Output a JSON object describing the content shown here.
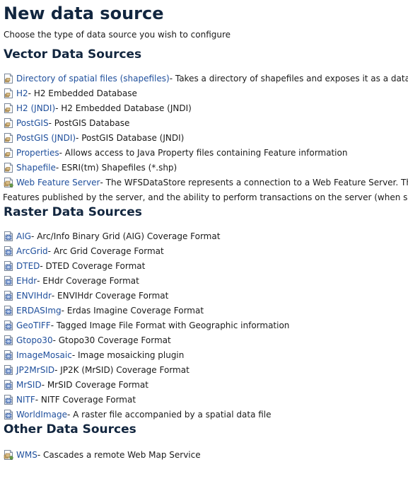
{
  "page": {
    "title": "New data source",
    "subtitle": "Choose the type of data source you wish to configure"
  },
  "vector": {
    "heading": "Vector Data Sources",
    "items": [
      {
        "label": "Directory of spatial files (shapefiles)",
        "desc": " - Takes a directory of shapefiles and exposes it as a data store",
        "icon": "vector-store-icon"
      },
      {
        "label": "H2",
        "desc": " - H2 Embedded Database",
        "icon": "vector-store-icon"
      },
      {
        "label": "H2 (JNDI)",
        "desc": " - H2 Embedded Database (JNDI)",
        "icon": "vector-store-icon"
      },
      {
        "label": "PostGIS",
        "desc": " - PostGIS Database",
        "icon": "vector-store-icon"
      },
      {
        "label": "PostGIS (JNDI)",
        "desc": " - PostGIS Database (JNDI)",
        "icon": "vector-store-icon"
      },
      {
        "label": "Properties",
        "desc": " - Allows access to Java Property files containing Feature information",
        "icon": "vector-store-icon"
      },
      {
        "label": "Shapefile",
        "desc": " - ESRI(tm) Shapefiles (*.shp)",
        "icon": "vector-store-icon"
      },
      {
        "label": "Web Feature Server",
        "desc": " - The WFSDataStore represents a connection to a Web Feature Server. This conn",
        "desc2": "Features published by the server, and the ability to perform transactions on the server (when supported / a",
        "icon": "remote-store-icon"
      }
    ]
  },
  "raster": {
    "heading": "Raster Data Sources",
    "items": [
      {
        "label": "AIG",
        "desc": " - Arc/Info Binary Grid (AIG) Coverage Format"
      },
      {
        "label": "ArcGrid",
        "desc": " - Arc Grid Coverage Format"
      },
      {
        "label": "DTED",
        "desc": " - DTED Coverage Format"
      },
      {
        "label": "EHdr",
        "desc": " - EHdr Coverage Format"
      },
      {
        "label": "ENVIHdr",
        "desc": " - ENVIHdr Coverage Format"
      },
      {
        "label": "ERDASImg",
        "desc": " - Erdas Imagine Coverage Format"
      },
      {
        "label": "GeoTIFF",
        "desc": " - Tagged Image File Format with Geographic information"
      },
      {
        "label": "Gtopo30",
        "desc": " - Gtopo30 Coverage Format"
      },
      {
        "label": "ImageMosaic",
        "desc": " - Image mosaicking plugin"
      },
      {
        "label": "JP2MrSID",
        "desc": " - JP2K (MrSID) Coverage Format"
      },
      {
        "label": "MrSID",
        "desc": " - MrSID Coverage Format"
      },
      {
        "label": "NITF",
        "desc": " - NITF Coverage Format"
      },
      {
        "label": "WorldImage",
        "desc": " - A raster file accompanied by a spatial data file"
      }
    ]
  },
  "other": {
    "heading": "Other Data Sources",
    "items": [
      {
        "label": "WMS",
        "desc": " - Cascades a remote Web Map Service"
      }
    ]
  },
  "colors": {
    "heading": "#12263f",
    "link": "#1f4f9c",
    "text": "#1a1a1a"
  }
}
